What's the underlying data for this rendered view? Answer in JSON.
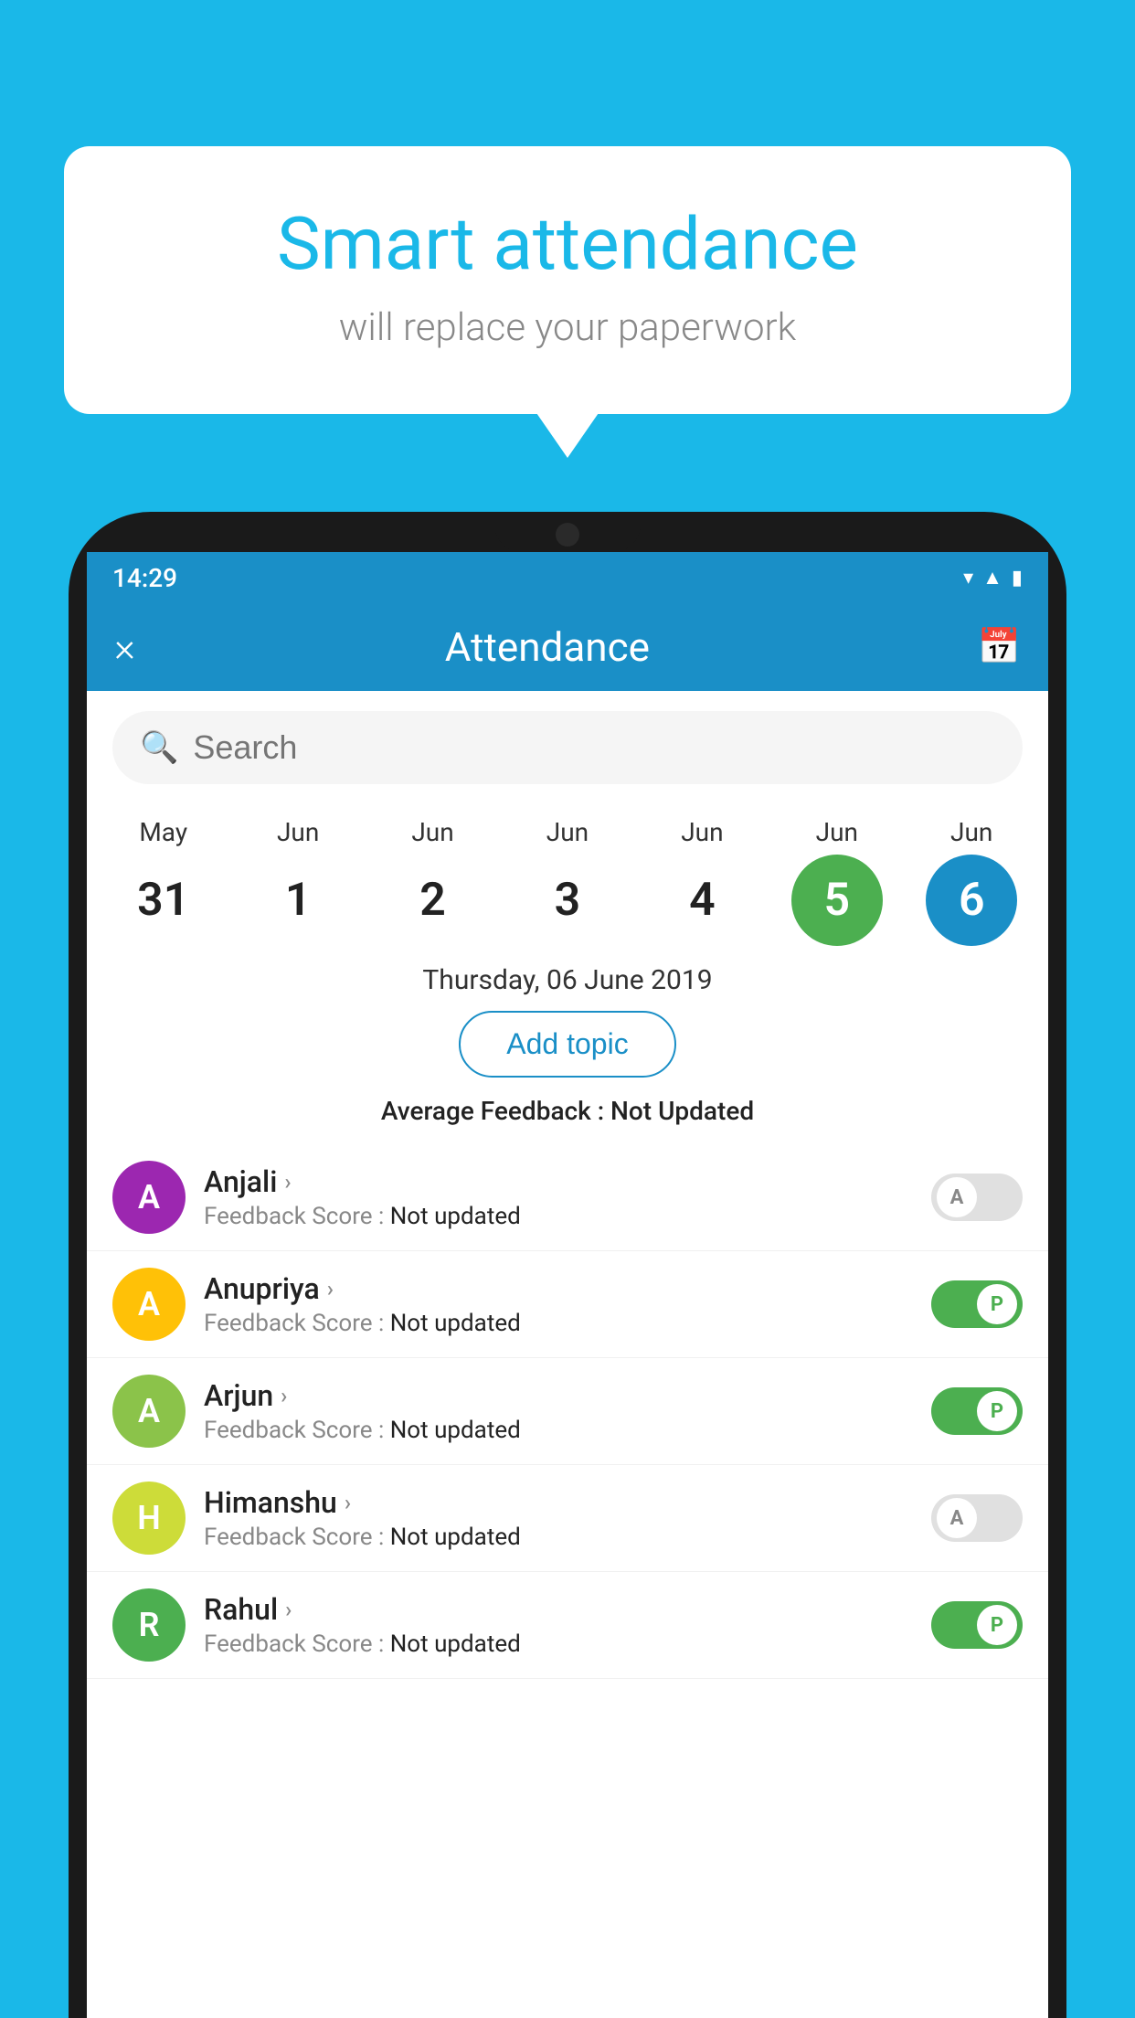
{
  "background": {
    "color": "#1ab8e8"
  },
  "speech_bubble": {
    "title": "Smart attendance",
    "subtitle": "will replace your paperwork"
  },
  "status_bar": {
    "time": "14:29",
    "icons": [
      "wifi",
      "signal",
      "battery"
    ]
  },
  "app_header": {
    "title": "Attendance",
    "close_label": "×",
    "calendar_icon": "📅"
  },
  "search": {
    "placeholder": "Search"
  },
  "dates": [
    {
      "month": "May",
      "day": "31",
      "style": "normal"
    },
    {
      "month": "Jun",
      "day": "1",
      "style": "normal"
    },
    {
      "month": "Jun",
      "day": "2",
      "style": "normal"
    },
    {
      "month": "Jun",
      "day": "3",
      "style": "normal"
    },
    {
      "month": "Jun",
      "day": "4",
      "style": "normal"
    },
    {
      "month": "Jun",
      "day": "5",
      "style": "selected-green"
    },
    {
      "month": "Jun",
      "day": "6",
      "style": "selected-blue"
    }
  ],
  "selected_date_label": "Thursday, 06 June 2019",
  "add_topic_label": "Add topic",
  "avg_feedback_label": "Average Feedback :",
  "avg_feedback_value": "Not Updated",
  "students": [
    {
      "name": "Anjali",
      "avatar_letter": "A",
      "avatar_color": "#9c27b0",
      "feedback_label": "Feedback Score :",
      "feedback_value": "Not updated",
      "toggle": "off",
      "toggle_letter": "A"
    },
    {
      "name": "Anupriya",
      "avatar_letter": "A",
      "avatar_color": "#ffc107",
      "feedback_label": "Feedback Score :",
      "feedback_value": "Not updated",
      "toggle": "on",
      "toggle_letter": "P"
    },
    {
      "name": "Arjun",
      "avatar_letter": "A",
      "avatar_color": "#8bc34a",
      "feedback_label": "Feedback Score :",
      "feedback_value": "Not updated",
      "toggle": "on",
      "toggle_letter": "P"
    },
    {
      "name": "Himanshu",
      "avatar_letter": "H",
      "avatar_color": "#cddc39",
      "feedback_label": "Feedback Score :",
      "feedback_value": "Not updated",
      "toggle": "off",
      "toggle_letter": "A"
    },
    {
      "name": "Rahul",
      "avatar_letter": "R",
      "avatar_color": "#4caf50",
      "feedback_label": "Feedback Score :",
      "feedback_value": "Not updated",
      "toggle": "on",
      "toggle_letter": "P"
    }
  ]
}
